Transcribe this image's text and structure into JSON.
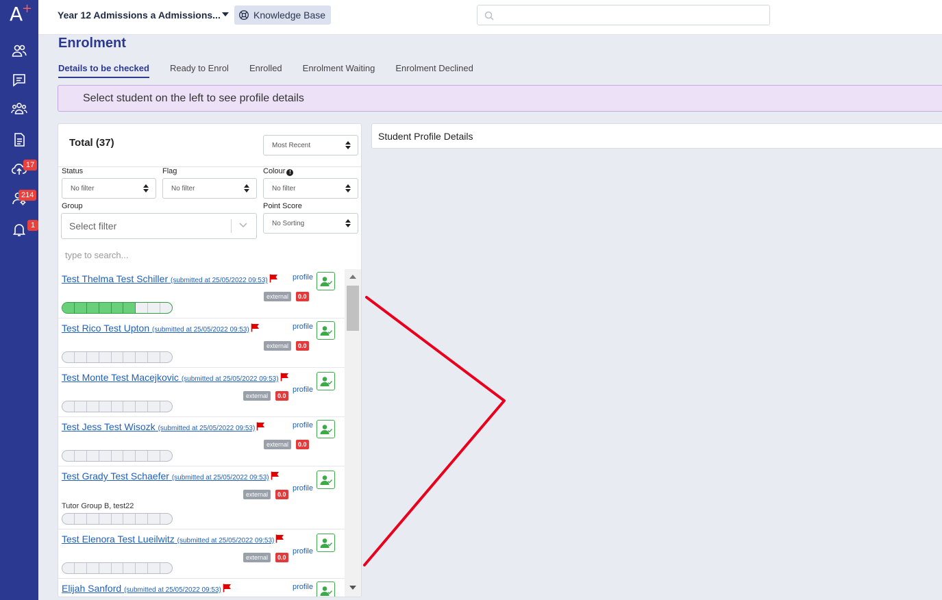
{
  "brand": {
    "logo_letter": "A",
    "logo_plus": "+"
  },
  "sidebar": {
    "items": [
      {
        "icon": "contacts-icon"
      },
      {
        "icon": "chat-icon"
      },
      {
        "icon": "users-group-icon"
      },
      {
        "icon": "document-icon"
      },
      {
        "icon": "cloud-upload-icon",
        "badge": "17"
      },
      {
        "icon": "user-settings-icon",
        "badge": "214"
      },
      {
        "icon": "bell-icon",
        "badge": "1"
      }
    ]
  },
  "topbar": {
    "context_title": "Year 12 Admissions a Admissions...",
    "knowledge_base_label": "Knowledge Base",
    "search_placeholder": ""
  },
  "page": {
    "title": "Enrolment",
    "tabs": [
      {
        "label": "Details to be checked",
        "active": true
      },
      {
        "label": "Ready to Enrol"
      },
      {
        "label": "Enrolled"
      },
      {
        "label": "Enrolment Waiting"
      },
      {
        "label": "Enrolment Declined"
      }
    ],
    "banner": "Select student on the left to see profile details"
  },
  "left_panel": {
    "total": "Total (37)",
    "sort_value": "Most Recent",
    "filters": {
      "status_label": "Status",
      "status_value": "No filter",
      "flag_label": "Flag",
      "flag_value": "No filter",
      "colour_label": "Colour",
      "colour_value": "No filter",
      "group_label": "Group",
      "group_placeholder": "Select filter",
      "point_score_label": "Point Score",
      "point_score_value": "No Sorting"
    },
    "search_placeholder": "type to search...",
    "students": [
      {
        "name": "Test Thelma Test Schiller",
        "submitted": "(submitted at 25/05/2022 09:53)",
        "profile": "profile",
        "tag": "external",
        "score": "0.0",
        "progress": 0.67,
        "group": ""
      },
      {
        "name": "Test Rico Test Upton",
        "submitted": "(submitted at 25/05/2022 09:53)",
        "profile": "profile",
        "tag": "external",
        "score": "0.0",
        "progress": 0,
        "group": ""
      },
      {
        "name": "Test Monte Test Macejkovic",
        "submitted": "(submitted at 25/05/2022 09:53)",
        "profile": "profile",
        "tag": "external",
        "score": "0.0",
        "progress": 0,
        "group": ""
      },
      {
        "name": "Test Jess Test Wisozk",
        "submitted": "(submitted at 25/05/2022 09:53)",
        "profile": "profile",
        "tag": "external",
        "score": "0.0",
        "progress": 0,
        "group": ""
      },
      {
        "name": "Test Grady Test Schaefer",
        "submitted": "(submitted at 25/05/2022 09:53)",
        "profile": "profile",
        "tag": "external",
        "score": "0.0",
        "progress": 0,
        "group": "Tutor Group B, test22"
      },
      {
        "name": "Test Elenora Test Lueilwitz",
        "submitted": "(submitted at 25/05/2022 09:53)",
        "profile": "profile",
        "tag": "external",
        "score": "0.0",
        "progress": 0,
        "group": ""
      },
      {
        "name": "Elijah Sanford",
        "submitted": "(submitted at 25/05/2022 09:53)",
        "profile": "profile",
        "tag": "",
        "score": "",
        "progress": 0,
        "group": ""
      }
    ]
  },
  "right_panel": {
    "title": "Student Profile Details"
  },
  "colors": {
    "sidebar": "#2b3990",
    "accent": "#2b3990",
    "flag": "#e00000",
    "annotation": "#e8001c",
    "success": "#3daa4a"
  }
}
